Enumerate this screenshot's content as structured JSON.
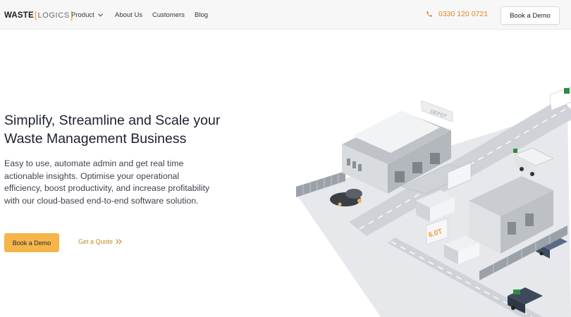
{
  "brand": {
    "logo_main": "WASTE",
    "logo_sub": "LOGICS"
  },
  "nav": {
    "product": "Product",
    "about": "About Us",
    "customers": "Customers",
    "blog": "Blog"
  },
  "header": {
    "phone": "0330 120 0721",
    "cta": "Book a Demo"
  },
  "hero": {
    "headline_line1": "Simplify, Streamline and Scale your",
    "headline_line2": "Waste Management Business",
    "paragraph": "Easy to use, automate admin and get real time actionable insights. Optimise your operational efficiency, boost productivity, and increase profitability with our cloud-based end-to-end software solution.",
    "primary_cta": "Book a Demo",
    "secondary_cta": "Get a Quote"
  },
  "illustration": {
    "depot_label": "DEPOT",
    "weight_label": "6.0T"
  },
  "colors": {
    "accent": "#f6b54b",
    "accent_text": "#e2861e",
    "header_bg": "#f7f7f7"
  },
  "icons": {
    "phone": "phone-icon",
    "product_dropdown": "chevron-down-icon",
    "quote_arrow": "double-chevron-right-icon"
  }
}
